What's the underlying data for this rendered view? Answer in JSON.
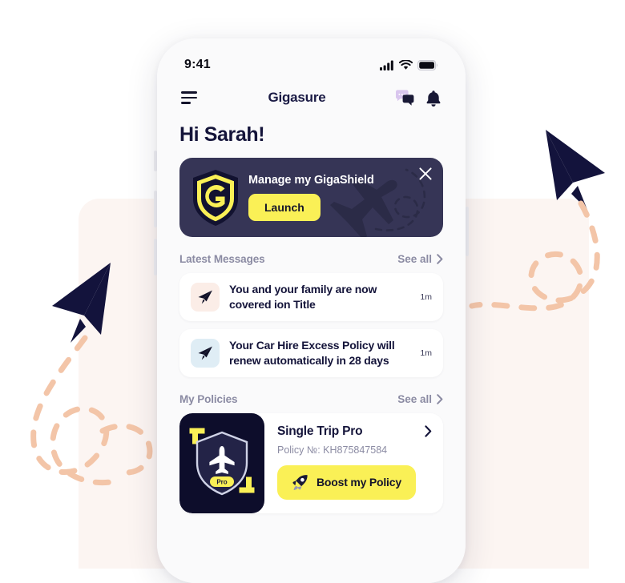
{
  "phone": {
    "status_bar": {
      "time": "9:41",
      "icons": [
        "cellular-signal-icon",
        "wifi-icon",
        "battery-icon"
      ]
    },
    "app_bar": {
      "menu_icon": "hamburger-menu-icon",
      "brand": "Gigasure",
      "actions": [
        {
          "icon": "chat-messages-icon"
        },
        {
          "icon": "notification-bell-icon"
        }
      ]
    },
    "greeting": "Hi Sarah!",
    "promo": {
      "logo_icon": "gigashield-logo-icon",
      "logo_letter": "G",
      "title": "Manage my GigaShield",
      "button_label": "Launch",
      "close_icon": "close-icon",
      "decor_icon": "airplane-trail-icon"
    },
    "messages_section": {
      "title": "Latest Messages",
      "see_all": "See all",
      "chevron_icon": "chevron-right-icon",
      "items": [
        {
          "icon": "paper-plane-icon",
          "icon_bg": "#FBEDE7",
          "text": "You and your family are now covered ion Title",
          "time": "1m"
        },
        {
          "icon": "paper-plane-icon",
          "icon_bg": "#DFEDF5",
          "text": "Your Car Hire Excess Policy will renew automatically in 28 days",
          "time": "1m"
        }
      ]
    },
    "policies_section": {
      "title": "My Policies",
      "see_all": "See all",
      "chevron_icon": "chevron-right-icon",
      "items": [
        {
          "thumb_icon": "shield-airplane-pro-icon",
          "badge": "Pro",
          "name": "Single Trip Pro",
          "number": "Policy №: KH875847584",
          "chevron_icon": "chevron-right-icon",
          "action_icon": "rocket-icon",
          "action_label": "Boost my Policy"
        }
      ]
    }
  },
  "decorations": {
    "left_plane_icon": "paper-plane-decor-icon",
    "right_plane_icon": "paper-plane-decor-icon",
    "dash_color": "#F3C5A8"
  },
  "colors": {
    "navy": "#14143a",
    "deep_navy": "#0d0d2b",
    "promo_bg": "#363556",
    "yellow": "#FAF056",
    "muted": "#8b8ba3",
    "cream": "#FCF5F2",
    "screen_bg": "#FAFAFB"
  }
}
